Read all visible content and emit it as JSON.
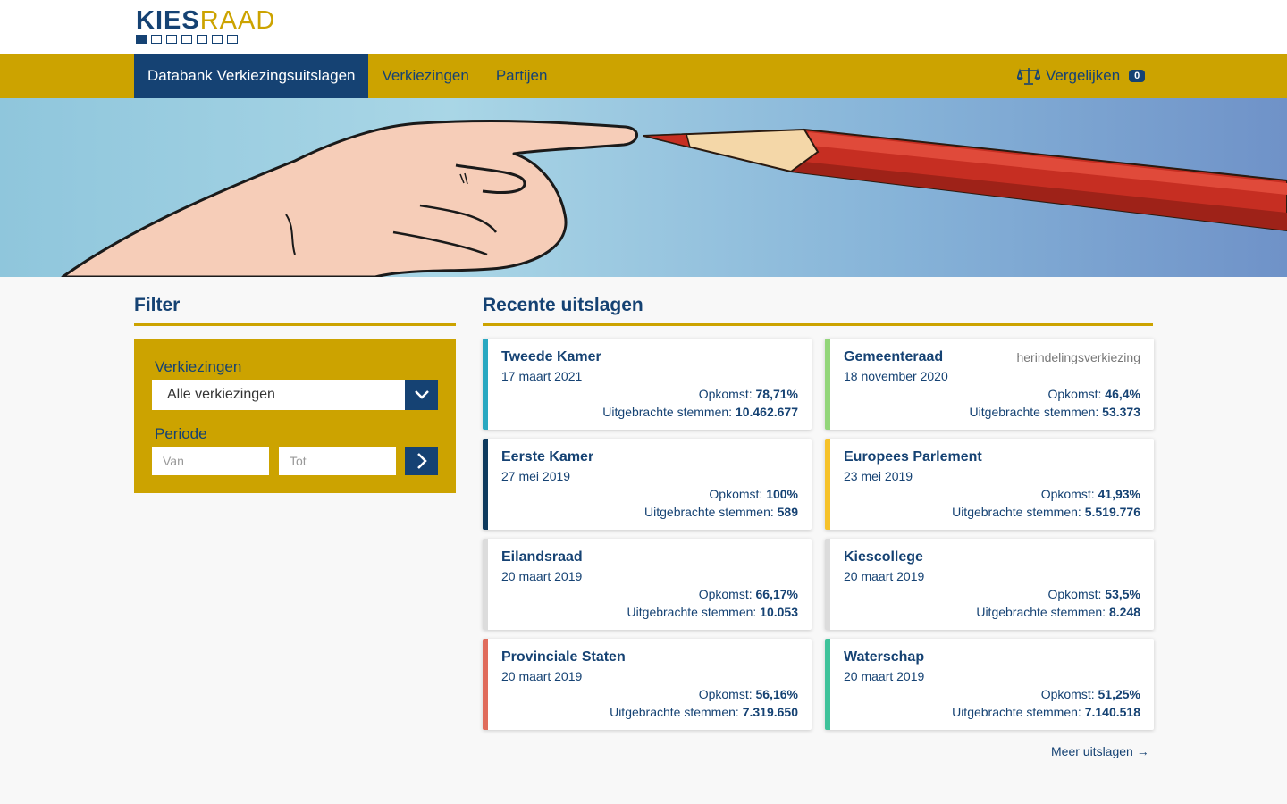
{
  "logo": {
    "kies": "KIES",
    "raad": "RAAD"
  },
  "nav": {
    "items": [
      "Databank Verkiezingsuitslagen",
      "Verkiezingen",
      "Partijen"
    ],
    "compare_label": "Vergelijken",
    "compare_count": "0"
  },
  "filter": {
    "title": "Filter",
    "verkiezingen_label": "Verkiezingen",
    "verkiezingen_value": "Alle verkiezingen",
    "periode_label": "Periode",
    "van_placeholder": "Van",
    "tot_placeholder": "Tot"
  },
  "results": {
    "title": "Recente uitslagen",
    "opkomst_label": "Opkomst:",
    "stemmen_label": "Uitgebrachte stemmen:",
    "cards": [
      {
        "title": "Tweede Kamer",
        "date": "17 maart 2021",
        "tag": "",
        "opkomst": "78,71%",
        "stemmen": "10.462.677",
        "color": "#29a8c1"
      },
      {
        "title": "Gemeenteraad",
        "date": "18 november 2020",
        "tag": "herindelingsverkiezing",
        "opkomst": "46,4%",
        "stemmen": "53.373",
        "color": "#93d67a"
      },
      {
        "title": "Eerste Kamer",
        "date": "27 mei 2019",
        "tag": "",
        "opkomst": "100%",
        "stemmen": "589",
        "color": "#0e3a5e"
      },
      {
        "title": "Europees Parlement",
        "date": "23 mei 2019",
        "tag": "",
        "opkomst": "41,93%",
        "stemmen": "5.519.776",
        "color": "#f6c22a"
      },
      {
        "title": "Eilandsraad",
        "date": "20 maart 2019",
        "tag": "",
        "opkomst": "66,17%",
        "stemmen": "10.053",
        "color": "#dcdcdc"
      },
      {
        "title": "Kiescollege",
        "date": "20 maart 2019",
        "tag": "",
        "opkomst": "53,5%",
        "stemmen": "8.248",
        "color": "#dcdcdc"
      },
      {
        "title": "Provinciale Staten",
        "date": "20 maart 2019",
        "tag": "",
        "opkomst": "56,16%",
        "stemmen": "7.319.650",
        "color": "#e06c5c"
      },
      {
        "title": "Waterschap",
        "date": "20 maart 2019",
        "tag": "",
        "opkomst": "51,25%",
        "stemmen": "7.140.518",
        "color": "#3fc29a"
      }
    ],
    "more_label": "Meer uitslagen →"
  },
  "colors": {
    "brand_blue": "#154273",
    "brand_yellow": "#cca300"
  },
  "icons": {
    "compare": "scale-icon",
    "select": "chevron-down-icon",
    "go": "chevron-right-icon"
  }
}
